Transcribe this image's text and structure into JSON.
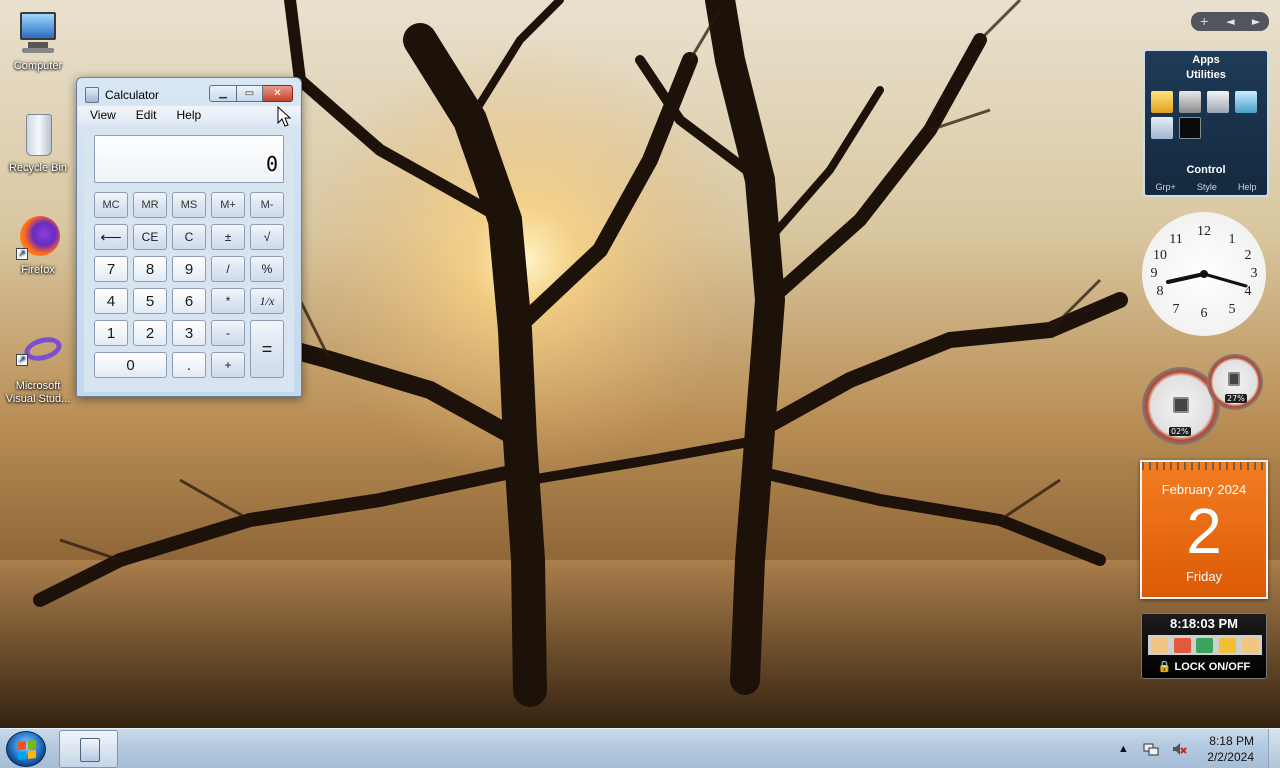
{
  "desktop": {
    "icons": [
      {
        "label": "Computer"
      },
      {
        "label": "Recycle Bin"
      },
      {
        "label": "Firefox"
      },
      {
        "label": "Microsoft Visual Stud..."
      }
    ]
  },
  "calculator": {
    "title": "Calculator",
    "menu": [
      "View",
      "Edit",
      "Help"
    ],
    "display": "0",
    "keys": {
      "mc": "MC",
      "mr": "MR",
      "ms": "MS",
      "mplus": "M+",
      "mminus": "M-",
      "back": "⟵",
      "ce": "CE",
      "c": "C",
      "pm": "±",
      "sqrt": "√",
      "k7": "7",
      "k8": "8",
      "k9": "9",
      "div": "/",
      "pct": "%",
      "k4": "4",
      "k5": "5",
      "k6": "6",
      "mul": "*",
      "inv": "1/x",
      "k1": "1",
      "k2": "2",
      "k3": "3",
      "sub": "-",
      "eq": "=",
      "k0": "0",
      "dot": ".",
      "add": "+"
    }
  },
  "gadgets": {
    "apps": {
      "title": "Apps",
      "subtitle": "Utilities",
      "control": "Control",
      "links": [
        "Grp+",
        "Style",
        "Help"
      ]
    },
    "cpu_meter": {
      "cpu": "02%",
      "memory": "27%"
    },
    "calendar": {
      "month": "February 2024",
      "day": "2",
      "weekday": "Friday"
    },
    "lock": {
      "time": "8:18:03 PM",
      "label": "LOCK ON/OFF"
    },
    "controls": {
      "add": "+",
      "prev": "◄",
      "next": "►"
    }
  },
  "taskbar": {
    "time": "8:18 PM",
    "date": "2/2/2024",
    "tray_arrow": "▲"
  },
  "colors": {
    "calendar": "#e8650f",
    "taskbar": "#b4c9df",
    "close_button": "#c5442b"
  }
}
